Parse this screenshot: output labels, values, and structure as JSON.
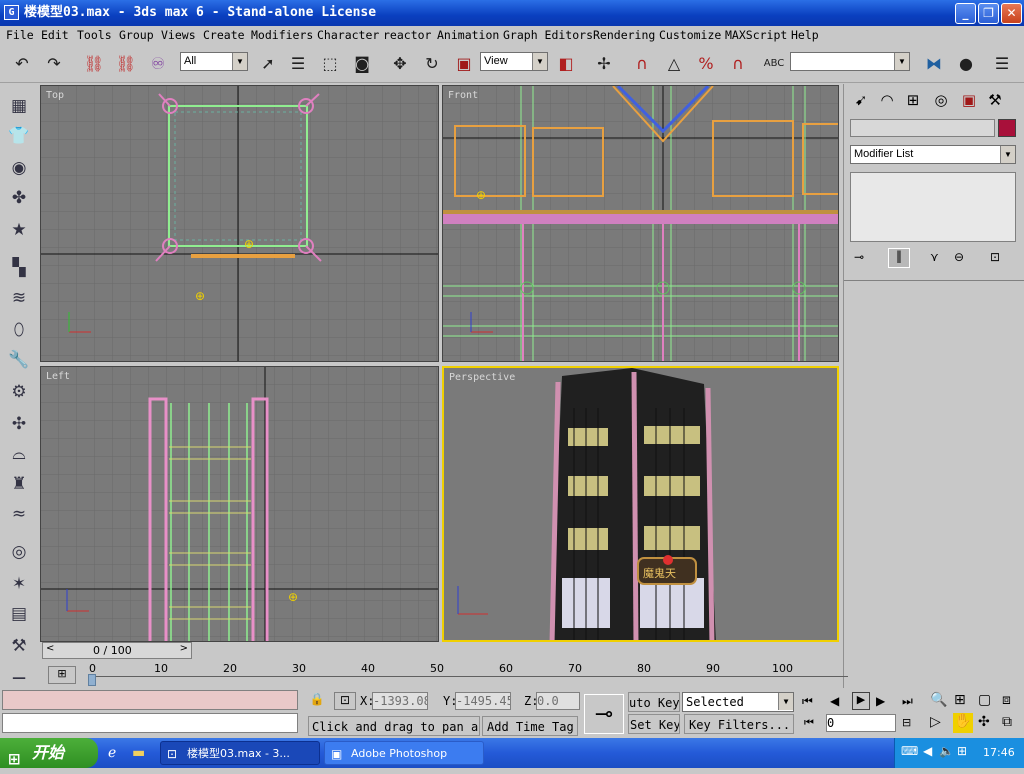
{
  "window": {
    "title": "楼模型03.max - 3ds max 6 - Stand-alone License",
    "icon_label": "G"
  },
  "menu": [
    "File",
    "Edit",
    "Tools",
    "Group",
    "Views",
    "Create",
    "Modifiers",
    "Character",
    "reactor",
    "Animation",
    "Graph Editors",
    "Rendering",
    "Customize",
    "MAXScript",
    "Help"
  ],
  "toolbar": {
    "selection_filter": "All",
    "ref_coord": "View",
    "named_selection": "",
    "icons": [
      "undo-icon",
      "redo-icon",
      "select-link-icon",
      "unlink-icon",
      "bind-space-warp-icon",
      "select-object-icon",
      "select-by-name-icon",
      "rect-region-icon",
      "window-crossing-icon",
      "move-icon",
      "rotate-icon",
      "scale-icon",
      "pivot-icon",
      "manipulate-icon",
      "snap-icon",
      "angle-snap-icon",
      "percent-snap-icon",
      "spinner-snap-icon",
      "edit-named-sel-icon",
      "mirror-icon",
      "align-icon",
      "layers-icon"
    ]
  },
  "viewports": {
    "top": "Top",
    "front": "Front",
    "left": "Left",
    "perspective": "Perspective"
  },
  "command_panel": {
    "name_field": "",
    "object_color": "#a8103a",
    "modifier_list": "Modifier List",
    "tabs": [
      "create-tab-icon",
      "modify-tab-icon",
      "hierarchy-tab-icon",
      "motion-tab-icon",
      "display-tab-icon",
      "utilities-tab-icon"
    ]
  },
  "time_slider": {
    "label": "0 / 100",
    "ticks": [
      "0",
      "10",
      "20",
      "30",
      "40",
      "50",
      "60",
      "70",
      "80",
      "90",
      "100"
    ]
  },
  "status": {
    "x_label": "X:",
    "x_value": "-1393.08",
    "y_label": "Y:",
    "y_value": "-1495.45",
    "z_label": "Z:",
    "z_value": "0.0",
    "prompt": "Click and drag to pan a",
    "add_time_tag": "Add Time Tag",
    "auto_key": "uto Key",
    "set_key": "Set Key",
    "selected": "Selected",
    "key_filters": "Key Filters...",
    "frame": "0"
  },
  "taskbar": {
    "start": "开始",
    "task1": "楼模型03.max - 3...",
    "task2": "Adobe Photoshop",
    "clock": "17:46"
  },
  "colors": {
    "viewport_bg": "#7a7a7a",
    "active_border": "#f0d000",
    "selection": "#90ee90",
    "shape_orange": "#e8a040"
  }
}
